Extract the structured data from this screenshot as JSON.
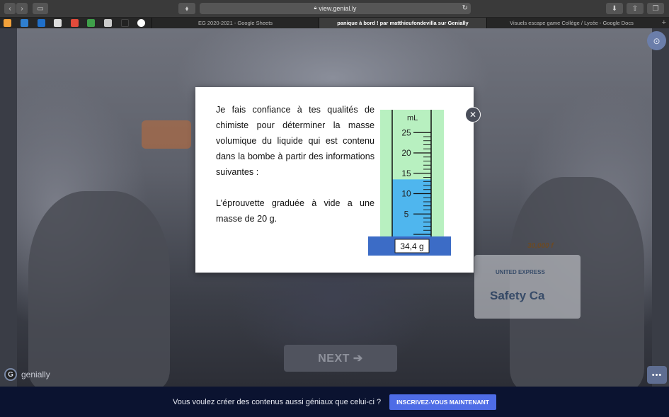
{
  "browser": {
    "url": "view.genial.ly",
    "tabs": [
      {
        "label": "EG 2020-2021 - Google Sheets",
        "active": false
      },
      {
        "label": "panique à bord ! par matthieufondevilla sur Genially",
        "active": true
      },
      {
        "label": "Visuels escape game Collège / Lycée - Google Docs",
        "active": false
      }
    ]
  },
  "modal": {
    "paragraph1": "Je fais confiance à tes qualités de chimiste pour déterminer la masse volumique du liquide qui est contenu dans la bombe à partir des informations suivantes :",
    "paragraph2": "L’éprouvette graduée à vide a une masse de 20 g.",
    "cylinder": {
      "unit": "mL",
      "ticks": [
        "25",
        "20",
        "15",
        "10",
        "5"
      ],
      "liquid_level_ml": 13.5,
      "scale_max_ml": 25,
      "scale_reading": "34,4 g"
    }
  },
  "stage": {
    "next_label": "NEXT ➔",
    "safety_brand": "UNITED EXPRESS",
    "safety_label": "Safety Ca",
    "seat_number": "30,000 f"
  },
  "brand": {
    "name": "genially",
    "icon": "genially-logo-icon"
  },
  "banner": {
    "text": "Vous voulez créer des contenus aussi géniaux que celui-ci ?",
    "button": "INSCRIVEZ-VOUS MAINTENANT"
  },
  "colors": {
    "banner_bg": "#0b1330",
    "signup_button": "#4e6ce6",
    "cylinder_bg": "#b8f0c0",
    "liquid": "#4fb6ee",
    "scale_base": "#3c6cc6"
  }
}
